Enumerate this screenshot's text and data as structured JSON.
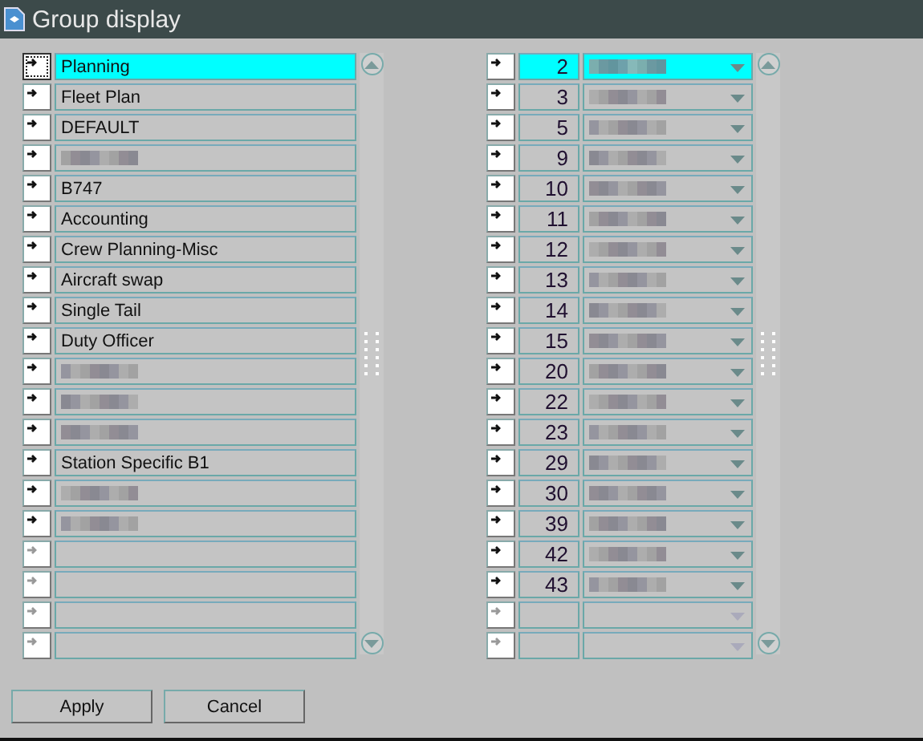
{
  "window": {
    "title": "Group display"
  },
  "groups": [
    {
      "kind": "text",
      "label": "Planning",
      "selected": true
    },
    {
      "kind": "text",
      "label": "Fleet Plan",
      "selected": false
    },
    {
      "kind": "text",
      "label": "DEFAULT",
      "selected": false
    },
    {
      "kind": "redacted",
      "selected": false
    },
    {
      "kind": "text",
      "label": "B747",
      "selected": false
    },
    {
      "kind": "text",
      "label": "Accounting",
      "selected": false
    },
    {
      "kind": "text",
      "label": "Crew Planning-Misc",
      "selected": false
    },
    {
      "kind": "text",
      "label": "Aircraft swap",
      "selected": false
    },
    {
      "kind": "text",
      "label": "Single Tail",
      "selected": false
    },
    {
      "kind": "text",
      "label": "Duty Officer",
      "selected": false
    },
    {
      "kind": "redacted",
      "selected": false
    },
    {
      "kind": "redacted",
      "selected": false
    },
    {
      "kind": "redacted",
      "selected": false
    },
    {
      "kind": "text",
      "label": "Station Specific B1",
      "selected": false
    },
    {
      "kind": "redacted",
      "selected": false
    },
    {
      "kind": "redacted",
      "selected": false
    },
    {
      "kind": "empty",
      "selected": false
    },
    {
      "kind": "empty",
      "selected": false
    },
    {
      "kind": "empty",
      "selected": false
    },
    {
      "kind": "empty",
      "selected": false
    }
  ],
  "assignments": [
    {
      "kind": "filled",
      "number": "2",
      "selected": true
    },
    {
      "kind": "filled",
      "number": "3",
      "selected": false
    },
    {
      "kind": "filled",
      "number": "5",
      "selected": false
    },
    {
      "kind": "filled",
      "number": "9",
      "selected": false
    },
    {
      "kind": "filled",
      "number": "10",
      "selected": false
    },
    {
      "kind": "filled",
      "number": "11",
      "selected": false
    },
    {
      "kind": "filled",
      "number": "12",
      "selected": false
    },
    {
      "kind": "filled",
      "number": "13",
      "selected": false
    },
    {
      "kind": "filled",
      "number": "14",
      "selected": false
    },
    {
      "kind": "filled",
      "number": "15",
      "selected": false
    },
    {
      "kind": "filled",
      "number": "20",
      "selected": false
    },
    {
      "kind": "filled",
      "number": "22",
      "selected": false
    },
    {
      "kind": "filled",
      "number": "23",
      "selected": false
    },
    {
      "kind": "filled",
      "number": "29",
      "selected": false
    },
    {
      "kind": "filled",
      "number": "30",
      "selected": false
    },
    {
      "kind": "filled",
      "number": "39",
      "selected": false
    },
    {
      "kind": "filled",
      "number": "42",
      "selected": false
    },
    {
      "kind": "filled",
      "number": "43",
      "selected": false
    },
    {
      "kind": "empty",
      "selected": false
    },
    {
      "kind": "empty",
      "selected": false
    }
  ],
  "buttons": [
    "Apply",
    "Cancel"
  ]
}
